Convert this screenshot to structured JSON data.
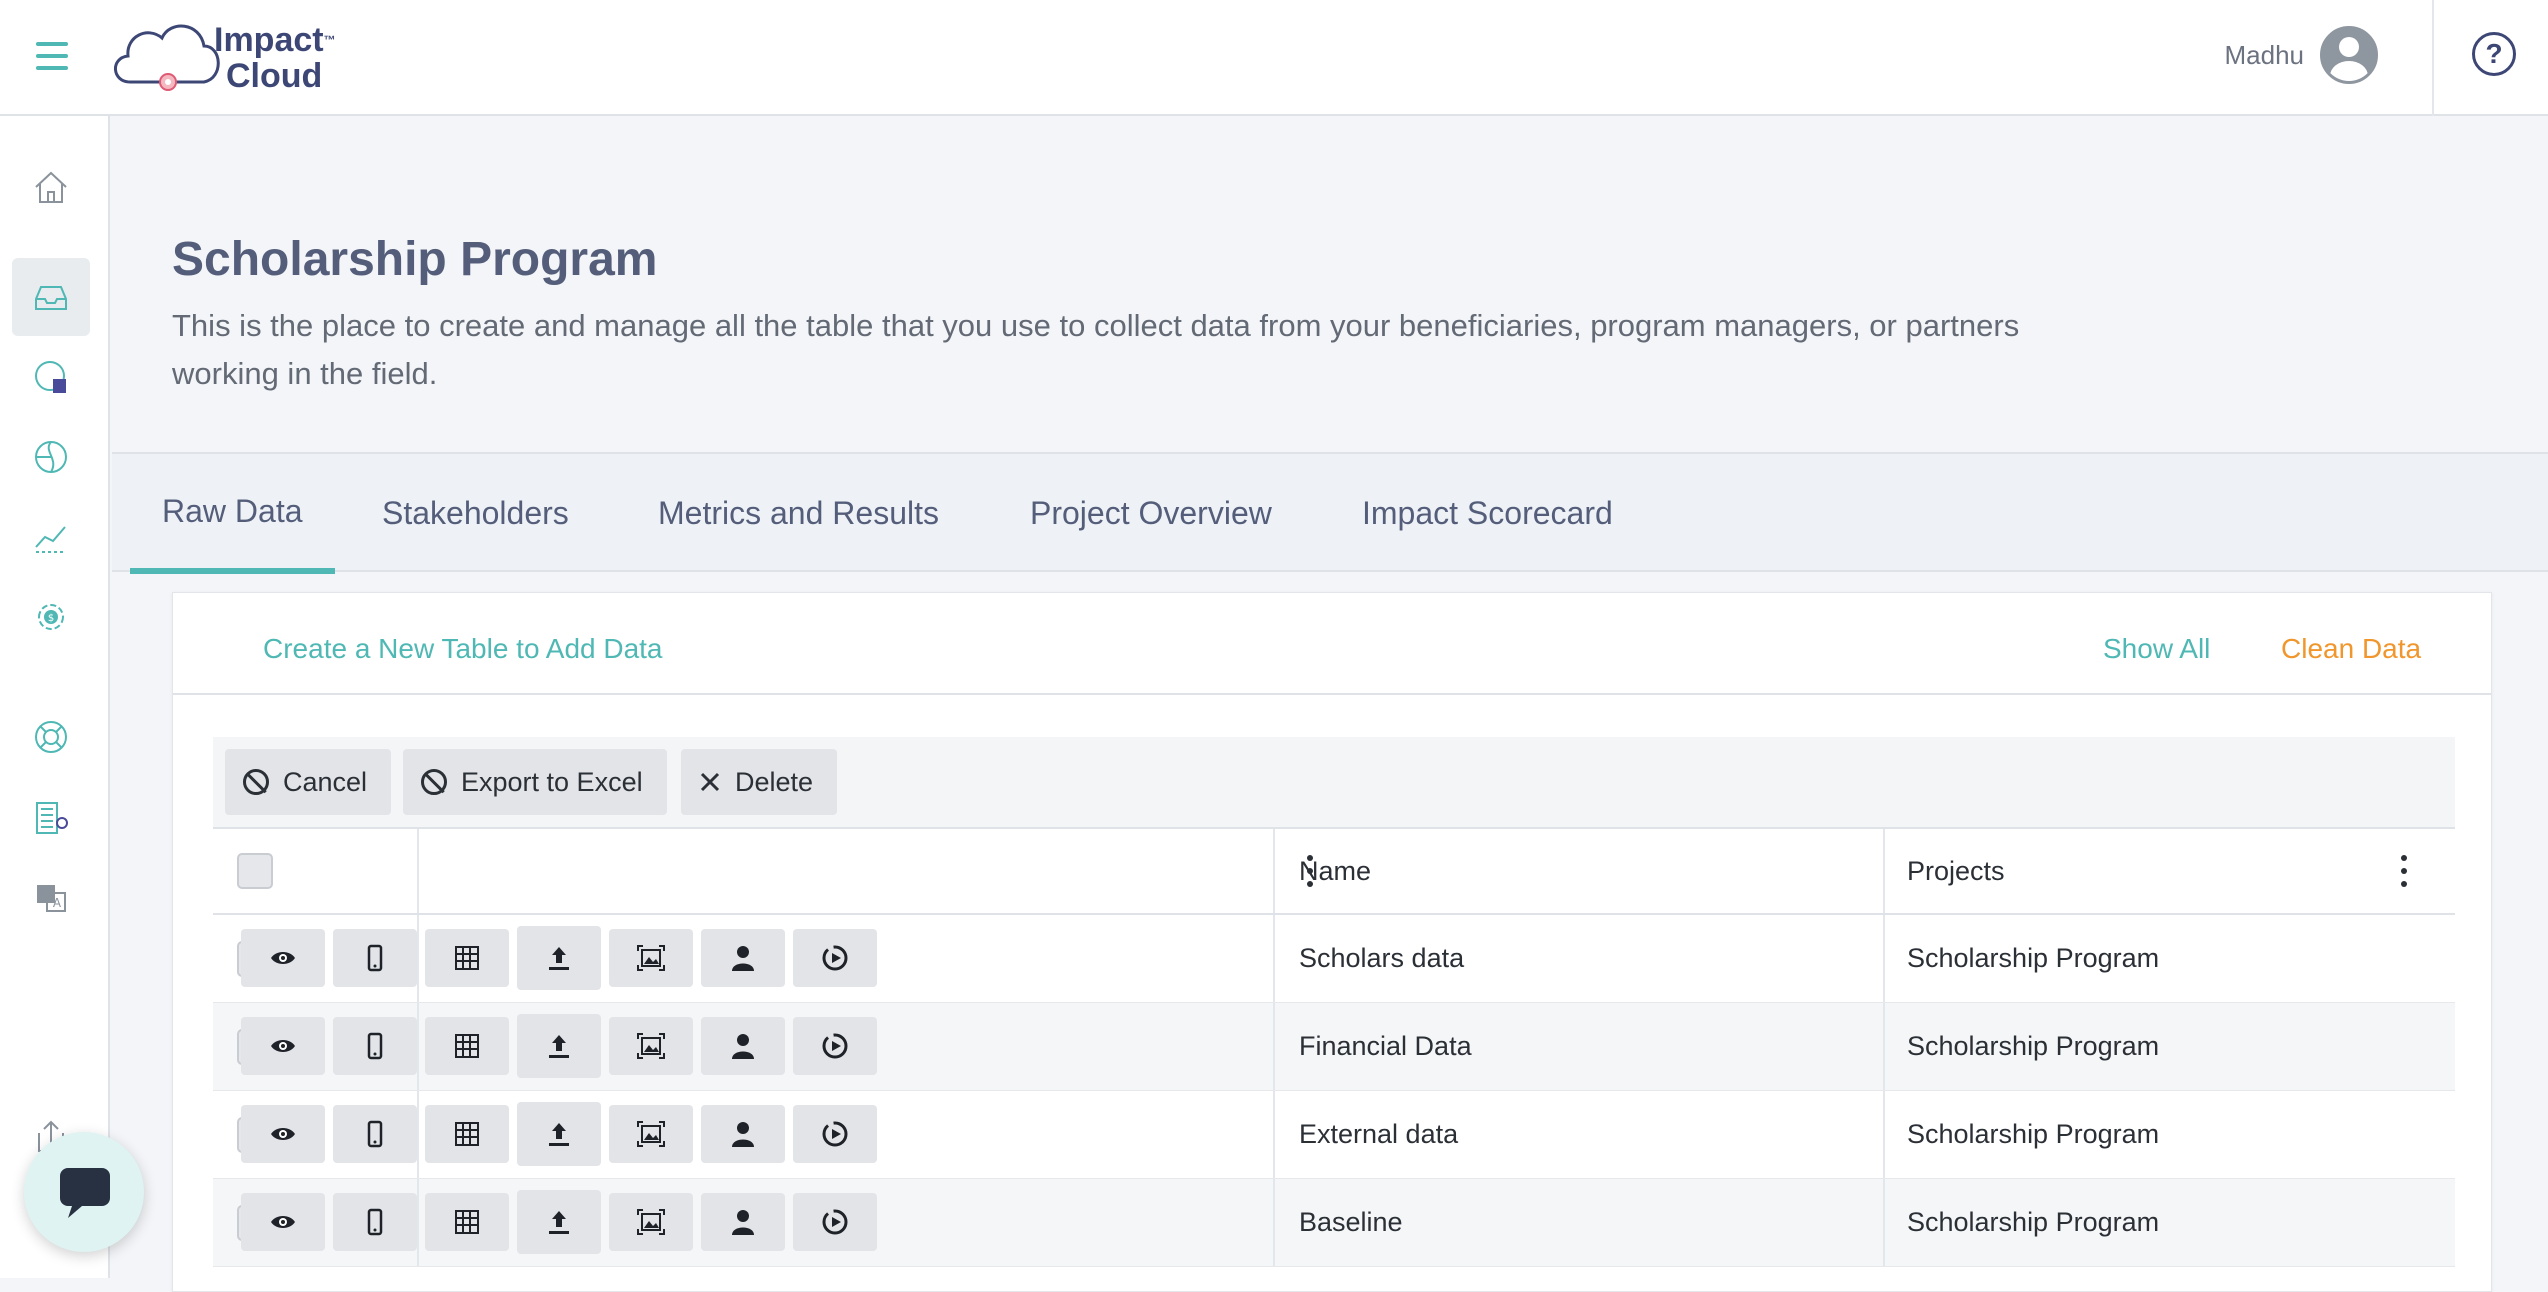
{
  "app": {
    "logo_line1": "Impact",
    "logo_tm": "™",
    "logo_line2": "Cloud",
    "user_name": "Madhu",
    "help_glyph": "?"
  },
  "sidebar": {
    "items": [
      {
        "icon": "home-icon"
      },
      {
        "icon": "inbox-icon",
        "active": true
      },
      {
        "icon": "pie-chart-icon"
      },
      {
        "icon": "globe-icon"
      },
      {
        "icon": "trend-line-icon"
      },
      {
        "icon": "dollar-cycle-icon"
      },
      {
        "icon": "lifebuoy-icon"
      },
      {
        "icon": "building-icon"
      },
      {
        "icon": "translate-icon"
      },
      {
        "icon": "share-icon"
      },
      {
        "icon": "landscape-icon"
      }
    ]
  },
  "page": {
    "title": "Scholarship Program",
    "description": "This is the place to create and manage all the table that you use to collect data from your beneficiaries, program managers, or partners working in the field."
  },
  "tabs": [
    {
      "label": "Raw Data",
      "active": true
    },
    {
      "label": "Stakeholders"
    },
    {
      "label": "Metrics and Results"
    },
    {
      "label": "Project Overview"
    },
    {
      "label": "Impact Scorecard"
    }
  ],
  "card": {
    "create_link": "Create a New Table to Add Data",
    "show_all": "Show All",
    "clean_data": "Clean Data"
  },
  "toolbar": {
    "cancel_label": "Cancel",
    "export_label": "Export to Excel",
    "delete_label": "Delete"
  },
  "table": {
    "columns": [
      "",
      "",
      "Name",
      "Projects"
    ],
    "rows": [
      {
        "name": "Scholars data",
        "project": "Scholarship Program"
      },
      {
        "name": "Financial Data",
        "project": "Scholarship Program"
      },
      {
        "name": "External data",
        "project": "Scholarship Program"
      },
      {
        "name": "Baseline",
        "project": "Scholarship Program"
      }
    ],
    "row_actions": [
      "eye-icon",
      "mobile-icon",
      "grid-icon",
      "upload-icon",
      "image-icon",
      "person-icon",
      "play-circle-icon"
    ]
  },
  "colors": {
    "accent": "#4fb8b4",
    "warning": "#f0962c",
    "brand": "#3d4775"
  }
}
